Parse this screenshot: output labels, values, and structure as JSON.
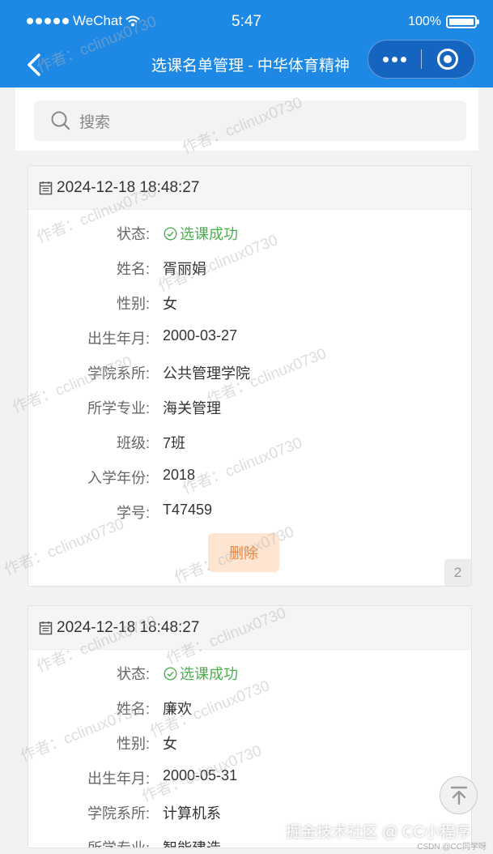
{
  "status_bar": {
    "carrier": "WeChat",
    "time": "5:47",
    "battery": "100%"
  },
  "nav": {
    "title": "选课名单管理 - 中华体育精神"
  },
  "search": {
    "placeholder": "搜索"
  },
  "records": [
    {
      "datetime": "2024-12-18 18:48:27",
      "fields": [
        {
          "label": "状态:",
          "value": "选课成功",
          "kind": "status"
        },
        {
          "label": "姓名:",
          "value": "胥丽娟"
        },
        {
          "label": "性别:",
          "value": "女"
        },
        {
          "label": "出生年月:",
          "value": "2000-03-27"
        },
        {
          "label": "学院系所:",
          "value": "公共管理学院"
        },
        {
          "label": "所学专业:",
          "value": "海关管理"
        },
        {
          "label": "班级:",
          "value": "7班"
        },
        {
          "label": "入学年份:",
          "value": "2018"
        },
        {
          "label": "学号:",
          "value": "T47459"
        }
      ],
      "delete_label": "删除",
      "index_badge": "2"
    },
    {
      "datetime": "2024-12-18 18:48:27",
      "fields": [
        {
          "label": "状态:",
          "value": "选课成功",
          "kind": "status"
        },
        {
          "label": "姓名:",
          "value": "廉欢"
        },
        {
          "label": "性别:",
          "value": "女"
        },
        {
          "label": "出生年月:",
          "value": "2000-05-31"
        },
        {
          "label": "学院系所:",
          "value": "计算机系"
        },
        {
          "label": "所学专业:",
          "value": "智能建造"
        }
      ]
    }
  ],
  "watermark": "作者：cclinux0730",
  "footer": {
    "brand": "掘金技术社区 @ CC小程序",
    "csdn": "CSDN @CC同学呀"
  },
  "colors": {
    "primary": "#1e88e5",
    "success": "#4caf50",
    "danger_text": "#f0883a",
    "danger_bg": "#fde5d1"
  },
  "icons": [
    "back-arrow-icon",
    "more-icon",
    "close-miniprogram-icon",
    "search-icon",
    "calendar-icon",
    "check-circle-icon",
    "back-to-top-icon"
  ]
}
